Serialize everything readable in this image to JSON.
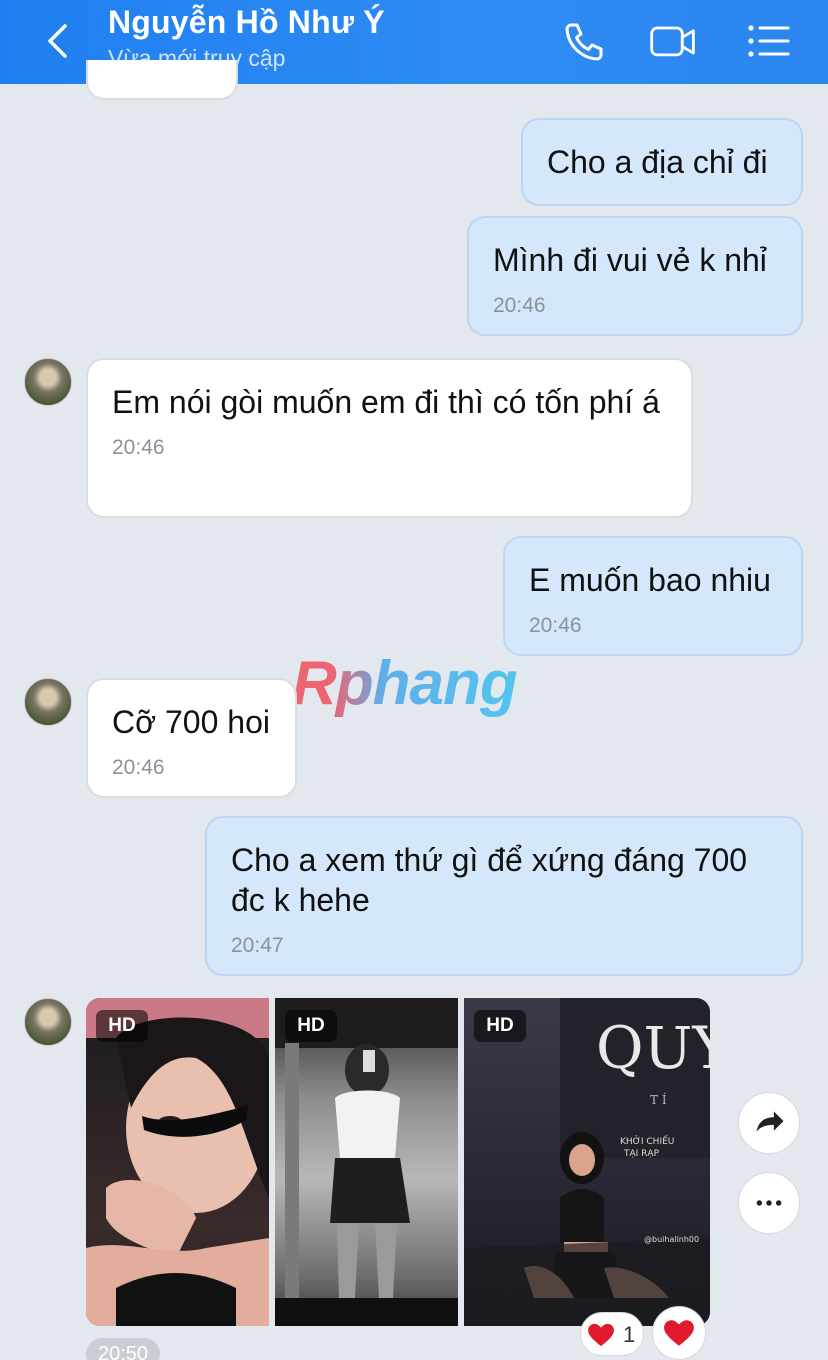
{
  "header": {
    "contact_name": "Nguyễn Hồ Như Ý",
    "status": "Vừa mới truy cập",
    "bg_color": "#2a86ee"
  },
  "messages": [
    {
      "dir": "out",
      "text": "Cho a địa chỉ đi",
      "time": ""
    },
    {
      "dir": "out",
      "text": "Mình đi vui vẻ k nhỉ",
      "time": "20:46"
    },
    {
      "dir": "in",
      "text": "Em nói gòi muốn em đi thì có tốn phí á",
      "time": "20:46"
    },
    {
      "dir": "out",
      "text": "E muốn bao nhiu",
      "time": "20:46"
    },
    {
      "dir": "in",
      "text": "Cỡ 700 hoi",
      "time": "20:46"
    },
    {
      "dir": "out",
      "text": "Cho a xem thứ gì để xứng đáng 700 đc k hehe",
      "time": "20:47"
    }
  ],
  "photos": {
    "badge": "HD",
    "photo3_sign_text": "QUY",
    "photo3_sub_text": "KHỞI CHIẾU TẠI RẠP",
    "photo3_tag": "@buihalinh00",
    "time": "20:50"
  },
  "reactions": {
    "heart_count": "1",
    "heart_icon": "♥"
  },
  "watermark": "Rphang",
  "colors": {
    "outgoing_bubble": "#d4e7fb",
    "incoming_bubble": "#ffffff",
    "chat_background": "#e3e8ee",
    "heart": "#e0192d"
  }
}
